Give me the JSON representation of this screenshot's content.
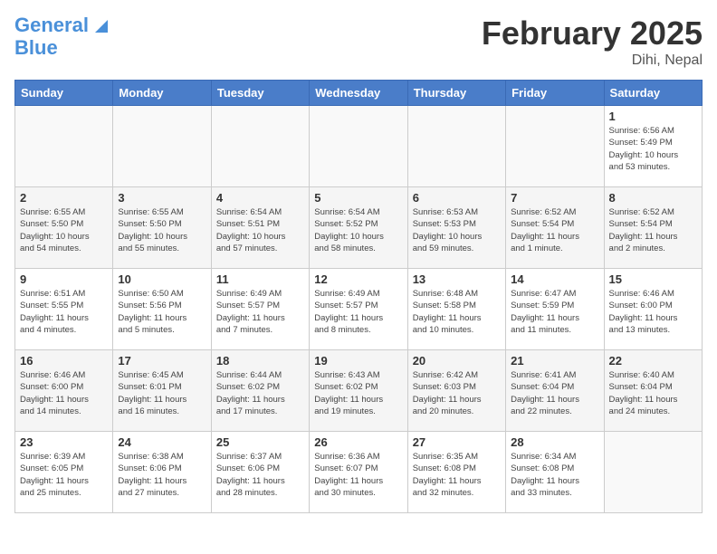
{
  "header": {
    "logo_line1": "General",
    "logo_line2": "Blue",
    "title": "February 2025",
    "subtitle": "Dihi, Nepal"
  },
  "days_of_week": [
    "Sunday",
    "Monday",
    "Tuesday",
    "Wednesday",
    "Thursday",
    "Friday",
    "Saturday"
  ],
  "weeks": [
    [
      {
        "day": "",
        "info": ""
      },
      {
        "day": "",
        "info": ""
      },
      {
        "day": "",
        "info": ""
      },
      {
        "day": "",
        "info": ""
      },
      {
        "day": "",
        "info": ""
      },
      {
        "day": "",
        "info": ""
      },
      {
        "day": "1",
        "info": "Sunrise: 6:56 AM\nSunset: 5:49 PM\nDaylight: 10 hours\nand 53 minutes."
      }
    ],
    [
      {
        "day": "2",
        "info": "Sunrise: 6:55 AM\nSunset: 5:50 PM\nDaylight: 10 hours\nand 54 minutes."
      },
      {
        "day": "3",
        "info": "Sunrise: 6:55 AM\nSunset: 5:50 PM\nDaylight: 10 hours\nand 55 minutes."
      },
      {
        "day": "4",
        "info": "Sunrise: 6:54 AM\nSunset: 5:51 PM\nDaylight: 10 hours\nand 57 minutes."
      },
      {
        "day": "5",
        "info": "Sunrise: 6:54 AM\nSunset: 5:52 PM\nDaylight: 10 hours\nand 58 minutes."
      },
      {
        "day": "6",
        "info": "Sunrise: 6:53 AM\nSunset: 5:53 PM\nDaylight: 10 hours\nand 59 minutes."
      },
      {
        "day": "7",
        "info": "Sunrise: 6:52 AM\nSunset: 5:54 PM\nDaylight: 11 hours\nand 1 minute."
      },
      {
        "day": "8",
        "info": "Sunrise: 6:52 AM\nSunset: 5:54 PM\nDaylight: 11 hours\nand 2 minutes."
      }
    ],
    [
      {
        "day": "9",
        "info": "Sunrise: 6:51 AM\nSunset: 5:55 PM\nDaylight: 11 hours\nand 4 minutes."
      },
      {
        "day": "10",
        "info": "Sunrise: 6:50 AM\nSunset: 5:56 PM\nDaylight: 11 hours\nand 5 minutes."
      },
      {
        "day": "11",
        "info": "Sunrise: 6:49 AM\nSunset: 5:57 PM\nDaylight: 11 hours\nand 7 minutes."
      },
      {
        "day": "12",
        "info": "Sunrise: 6:49 AM\nSunset: 5:57 PM\nDaylight: 11 hours\nand 8 minutes."
      },
      {
        "day": "13",
        "info": "Sunrise: 6:48 AM\nSunset: 5:58 PM\nDaylight: 11 hours\nand 10 minutes."
      },
      {
        "day": "14",
        "info": "Sunrise: 6:47 AM\nSunset: 5:59 PM\nDaylight: 11 hours\nand 11 minutes."
      },
      {
        "day": "15",
        "info": "Sunrise: 6:46 AM\nSunset: 6:00 PM\nDaylight: 11 hours\nand 13 minutes."
      }
    ],
    [
      {
        "day": "16",
        "info": "Sunrise: 6:46 AM\nSunset: 6:00 PM\nDaylight: 11 hours\nand 14 minutes."
      },
      {
        "day": "17",
        "info": "Sunrise: 6:45 AM\nSunset: 6:01 PM\nDaylight: 11 hours\nand 16 minutes."
      },
      {
        "day": "18",
        "info": "Sunrise: 6:44 AM\nSunset: 6:02 PM\nDaylight: 11 hours\nand 17 minutes."
      },
      {
        "day": "19",
        "info": "Sunrise: 6:43 AM\nSunset: 6:02 PM\nDaylight: 11 hours\nand 19 minutes."
      },
      {
        "day": "20",
        "info": "Sunrise: 6:42 AM\nSunset: 6:03 PM\nDaylight: 11 hours\nand 20 minutes."
      },
      {
        "day": "21",
        "info": "Sunrise: 6:41 AM\nSunset: 6:04 PM\nDaylight: 11 hours\nand 22 minutes."
      },
      {
        "day": "22",
        "info": "Sunrise: 6:40 AM\nSunset: 6:04 PM\nDaylight: 11 hours\nand 24 minutes."
      }
    ],
    [
      {
        "day": "23",
        "info": "Sunrise: 6:39 AM\nSunset: 6:05 PM\nDaylight: 11 hours\nand 25 minutes."
      },
      {
        "day": "24",
        "info": "Sunrise: 6:38 AM\nSunset: 6:06 PM\nDaylight: 11 hours\nand 27 minutes."
      },
      {
        "day": "25",
        "info": "Sunrise: 6:37 AM\nSunset: 6:06 PM\nDaylight: 11 hours\nand 28 minutes."
      },
      {
        "day": "26",
        "info": "Sunrise: 6:36 AM\nSunset: 6:07 PM\nDaylight: 11 hours\nand 30 minutes."
      },
      {
        "day": "27",
        "info": "Sunrise: 6:35 AM\nSunset: 6:08 PM\nDaylight: 11 hours\nand 32 minutes."
      },
      {
        "day": "28",
        "info": "Sunrise: 6:34 AM\nSunset: 6:08 PM\nDaylight: 11 hours\nand 33 minutes."
      },
      {
        "day": "",
        "info": ""
      }
    ]
  ]
}
